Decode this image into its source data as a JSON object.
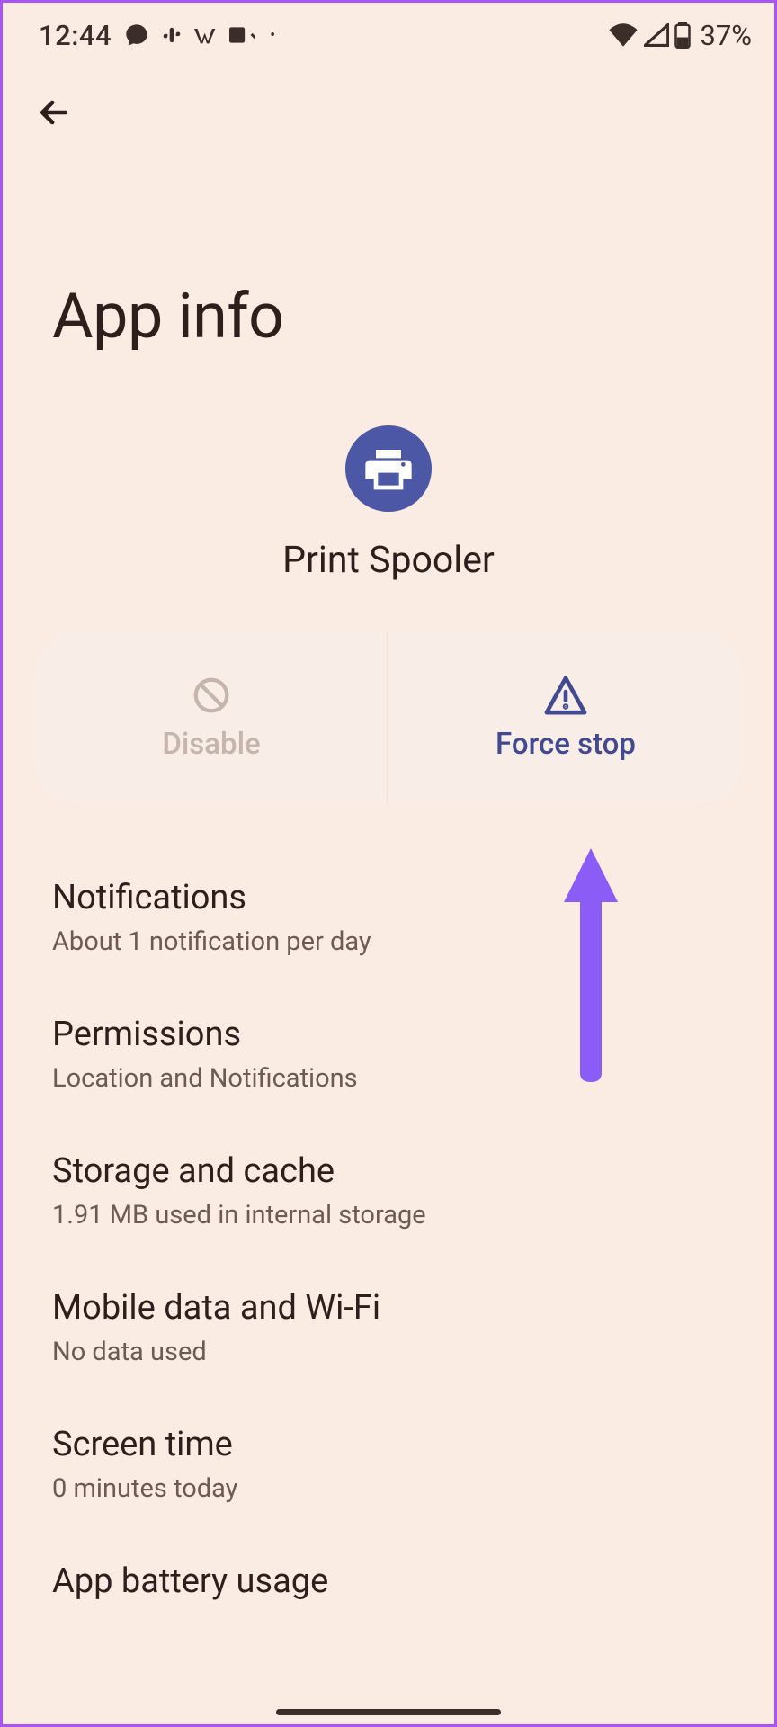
{
  "statusBar": {
    "time": "12:44",
    "batteryPercent": "37%"
  },
  "pageTitle": "App info",
  "app": {
    "name": "Print Spooler"
  },
  "actions": {
    "disable": "Disable",
    "forceStop": "Force stop"
  },
  "settings": [
    {
      "title": "Notifications",
      "subtitle": "About 1 notification per day"
    },
    {
      "title": "Permissions",
      "subtitle": "Location and Notifications"
    },
    {
      "title": "Storage and cache",
      "subtitle": "1.91 MB used in internal storage"
    },
    {
      "title": "Mobile data and Wi-Fi",
      "subtitle": "No data used"
    },
    {
      "title": "Screen time",
      "subtitle": "0 minutes today"
    },
    {
      "title": "App battery usage",
      "subtitle": ""
    }
  ]
}
